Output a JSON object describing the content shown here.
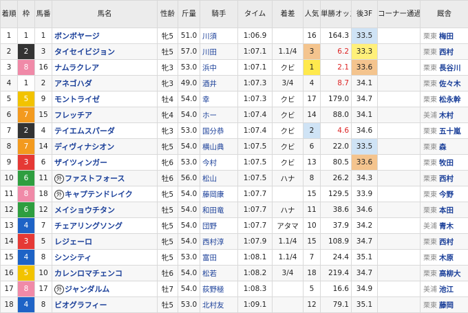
{
  "header": {
    "rank": "着順",
    "waku": "枠",
    "umaban": "馬番",
    "horse": "馬名",
    "sex_age": "性齢",
    "weight": "斤量",
    "jockey": "騎手",
    "time": "タイム",
    "margin": "着差",
    "popularity": "人気",
    "odds": "単勝オッズ",
    "last3f": "後3F",
    "corner": "コーナー通過順",
    "trainer": "厩舎"
  },
  "colors": {
    "waku": {
      "1": "#ffffff",
      "2": "#333333",
      "3": "#e53935",
      "4": "#1e63c6",
      "5": "#f2c300",
      "6": "#2e9e3f",
      "7": "#f39a1e",
      "8": "#f08aa8"
    },
    "popularity_1": "#ffe94d",
    "popularity_2": "#cfe3f5",
    "popularity_3": "#f4c48e",
    "last3f_1": "#cfe3f5",
    "last3f_2": "#fff07a",
    "last3f_3": "#f4c48e"
  },
  "rows": [
    {
      "rank": "1",
      "waku": "1",
      "umaban": "1",
      "mark": "",
      "horse": "ボンボヤージ",
      "sex_age": "牝5",
      "weight": "51.0",
      "jockey": "川須",
      "time": "1:06.9",
      "margin": "",
      "pop": "16",
      "odds": "164.3",
      "odds_red": false,
      "last3f": "33.5",
      "f_rank": 1,
      "corner": "",
      "area": "栗東",
      "trainer": "梅田"
    },
    {
      "rank": "2",
      "waku": "2",
      "umaban": "3",
      "mark": "",
      "horse": "タイセイビジョン",
      "sex_age": "牡5",
      "weight": "57.0",
      "jockey": "川田",
      "time": "1:07.1",
      "margin": "1.1/4",
      "pop": "3",
      "odds": "6.2",
      "odds_red": true,
      "last3f": "33.3",
      "f_rank": 2,
      "corner": "",
      "area": "栗東",
      "trainer": "西村"
    },
    {
      "rank": "3",
      "waku": "8",
      "umaban": "16",
      "mark": "",
      "horse": "ナムラクレア",
      "sex_age": "牝3",
      "weight": "53.0",
      "jockey": "浜中",
      "time": "1:07.1",
      "margin": "クビ",
      "pop": "1",
      "odds": "2.1",
      "odds_red": true,
      "last3f": "33.6",
      "f_rank": 3,
      "corner": "",
      "area": "栗東",
      "trainer": "長谷川"
    },
    {
      "rank": "4",
      "waku": "1",
      "umaban": "2",
      "mark": "",
      "horse": "アネゴハダ",
      "sex_age": "牝3",
      "weight": "49.0",
      "jockey": "酒井",
      "time": "1:07.3",
      "margin": "3/4",
      "pop": "4",
      "odds": "8.7",
      "odds_red": true,
      "last3f": "34.1",
      "f_rank": 0,
      "corner": "",
      "area": "栗東",
      "trainer": "佐々木"
    },
    {
      "rank": "5",
      "waku": "5",
      "umaban": "9",
      "mark": "",
      "horse": "モントライゼ",
      "sex_age": "牡4",
      "weight": "54.0",
      "jockey": "幸",
      "time": "1:07.3",
      "margin": "クビ",
      "pop": "17",
      "odds": "179.0",
      "odds_red": false,
      "last3f": "34.7",
      "f_rank": 0,
      "corner": "",
      "area": "栗東",
      "trainer": "松永幹"
    },
    {
      "rank": "6",
      "waku": "7",
      "umaban": "15",
      "mark": "",
      "horse": "フレッチア",
      "sex_age": "牝4",
      "weight": "54.0",
      "jockey": "ホー",
      "time": "1:07.4",
      "margin": "クビ",
      "pop": "14",
      "odds": "88.0",
      "odds_red": false,
      "last3f": "34.1",
      "f_rank": 0,
      "corner": "",
      "area": "美浦",
      "trainer": "木村"
    },
    {
      "rank": "7",
      "waku": "2",
      "umaban": "4",
      "mark": "",
      "horse": "テイエムスパーダ",
      "sex_age": "牝3",
      "weight": "53.0",
      "jockey": "国分恭",
      "time": "1:07.4",
      "margin": "クビ",
      "pop": "2",
      "odds": "4.6",
      "odds_red": true,
      "last3f": "34.6",
      "f_rank": 0,
      "corner": "",
      "area": "栗東",
      "trainer": "五十嵐"
    },
    {
      "rank": "8",
      "waku": "7",
      "umaban": "14",
      "mark": "",
      "horse": "ディヴィナシオン",
      "sex_age": "牝5",
      "weight": "54.0",
      "jockey": "横山典",
      "time": "1:07.5",
      "margin": "クビ",
      "pop": "6",
      "odds": "22.0",
      "odds_red": false,
      "last3f": "33.5",
      "f_rank": 1,
      "corner": "",
      "area": "栗東",
      "trainer": "森"
    },
    {
      "rank": "9",
      "waku": "3",
      "umaban": "6",
      "mark": "",
      "horse": "ザイツィンガー",
      "sex_age": "牝6",
      "weight": "53.0",
      "jockey": "今村",
      "time": "1:07.5",
      "margin": "クビ",
      "pop": "13",
      "odds": "80.5",
      "odds_red": false,
      "last3f": "33.6",
      "f_rank": 3,
      "corner": "",
      "area": "栗東",
      "trainer": "牧田"
    },
    {
      "rank": "10",
      "waku": "6",
      "umaban": "11",
      "mark": "外",
      "horse": "ファストフォース",
      "sex_age": "牡6",
      "weight": "56.0",
      "jockey": "松山",
      "time": "1:07.5",
      "margin": "ハナ",
      "pop": "8",
      "odds": "26.2",
      "odds_red": false,
      "last3f": "34.3",
      "f_rank": 0,
      "corner": "",
      "area": "栗東",
      "trainer": "西村"
    },
    {
      "rank": "11",
      "waku": "8",
      "umaban": "18",
      "mark": "外",
      "horse": "キャプテンドレイク",
      "sex_age": "牝5",
      "weight": "54.0",
      "jockey": "藤岡康",
      "time": "1:07.7",
      "margin": "",
      "pop": "15",
      "odds": "129.5",
      "odds_red": false,
      "last3f": "33.9",
      "f_rank": 0,
      "corner": "",
      "area": "栗東",
      "trainer": "今野"
    },
    {
      "rank": "12",
      "waku": "6",
      "umaban": "12",
      "mark": "",
      "horse": "メイショウチタン",
      "sex_age": "牡5",
      "weight": "54.0",
      "jockey": "和田竜",
      "time": "1:07.7",
      "margin": "ハナ",
      "pop": "11",
      "odds": "38.6",
      "odds_red": false,
      "last3f": "34.6",
      "f_rank": 0,
      "corner": "",
      "area": "栗東",
      "trainer": "本田"
    },
    {
      "rank": "13",
      "waku": "4",
      "umaban": "7",
      "mark": "",
      "horse": "チェアリングソング",
      "sex_age": "牝5",
      "weight": "54.0",
      "jockey": "団野",
      "time": "1:07.7",
      "margin": "アタマ",
      "pop": "10",
      "odds": "37.9",
      "odds_red": false,
      "last3f": "34.2",
      "f_rank": 0,
      "corner": "",
      "area": "美浦",
      "trainer": "青木"
    },
    {
      "rank": "14",
      "waku": "3",
      "umaban": "5",
      "mark": "",
      "horse": "レジェーロ",
      "sex_age": "牝5",
      "weight": "54.0",
      "jockey": "西村淳",
      "time": "1:07.9",
      "margin": "1.1/4",
      "pop": "15",
      "odds": "108.9",
      "odds_red": false,
      "last3f": "34.7",
      "f_rank": 0,
      "corner": "",
      "area": "栗東",
      "trainer": "西村"
    },
    {
      "rank": "15",
      "waku": "4",
      "umaban": "8",
      "mark": "",
      "horse": "シンシティ",
      "sex_age": "牝5",
      "weight": "53.0",
      "jockey": "富田",
      "time": "1:08.1",
      "margin": "1.1/4",
      "pop": "7",
      "odds": "24.4",
      "odds_red": false,
      "last3f": "35.1",
      "f_rank": 0,
      "corner": "",
      "area": "栗東",
      "trainer": "木原"
    },
    {
      "rank": "16",
      "waku": "5",
      "umaban": "10",
      "mark": "",
      "horse": "カレンロマチェンコ",
      "sex_age": "牡6",
      "weight": "54.0",
      "jockey": "松若",
      "time": "1:08.2",
      "margin": "3/4",
      "pop": "18",
      "odds": "219.4",
      "odds_red": false,
      "last3f": "34.7",
      "f_rank": 0,
      "corner": "",
      "area": "栗東",
      "trainer": "高柳大"
    },
    {
      "rank": "17",
      "waku": "8",
      "umaban": "17",
      "mark": "外",
      "horse": "ジャンダルム",
      "sex_age": "牡7",
      "weight": "54.0",
      "jockey": "荻野極",
      "time": "1:08.3",
      "margin": "",
      "pop": "5",
      "odds": "16.6",
      "odds_red": false,
      "last3f": "34.9",
      "f_rank": 0,
      "corner": "",
      "area": "美浦",
      "trainer": "池江"
    },
    {
      "rank": "18",
      "waku": "4",
      "umaban": "8",
      "mark": "",
      "horse": "ビオグラフィー",
      "sex_age": "牡5",
      "weight": "53.0",
      "jockey": "北村友",
      "time": "1:09.1",
      "margin": "",
      "pop": "12",
      "odds": "79.1",
      "odds_red": false,
      "last3f": "35.1",
      "f_rank": 0,
      "corner": "",
      "area": "栗東",
      "trainer": "藤岡"
    }
  ]
}
